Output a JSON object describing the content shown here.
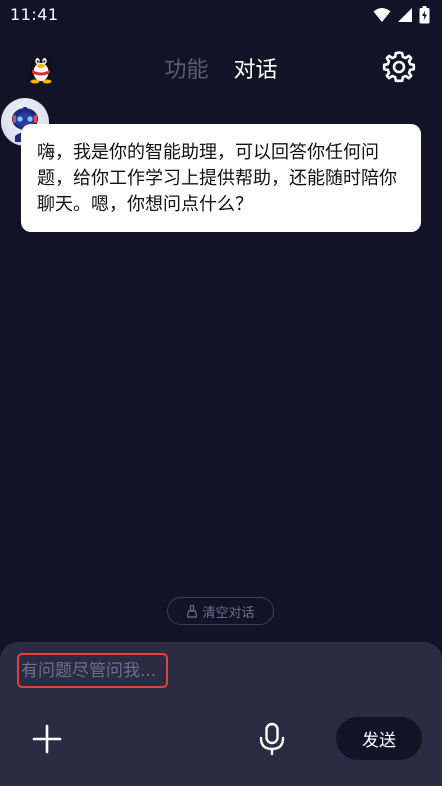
{
  "status_bar": {
    "time": "11:41",
    "icons": [
      "wifi-icon",
      "cellular-signal-icon",
      "battery-charging-icon"
    ]
  },
  "header": {
    "logo": "qq-penguin-icon",
    "tabs": [
      {
        "label": "功能",
        "active": false
      },
      {
        "label": "对话",
        "active": true
      }
    ],
    "settings_icon": "gear-icon"
  },
  "chat": {
    "messages": [
      {
        "sender": "bot",
        "avatar": "robot-avatar-icon",
        "text": "嗨，我是你的智能助理，可以回答你任何问题，给你工作学习上提供帮助，还能随时陪你聊天。嗯，你想问点什么？"
      }
    ],
    "clear_label": "清空对话",
    "clear_icon": "broom-icon"
  },
  "composer": {
    "placeholder": "有问题尽管问我...",
    "value": "",
    "plus_icon": "plus-icon",
    "mic_icon": "microphone-icon",
    "send_label": "发送"
  },
  "colors": {
    "background": "#131328",
    "panel": "#2b2c44",
    "bubble": "#ffffff",
    "highlight": "#e8412e",
    "inactive_tab": "#5b5d78"
  }
}
